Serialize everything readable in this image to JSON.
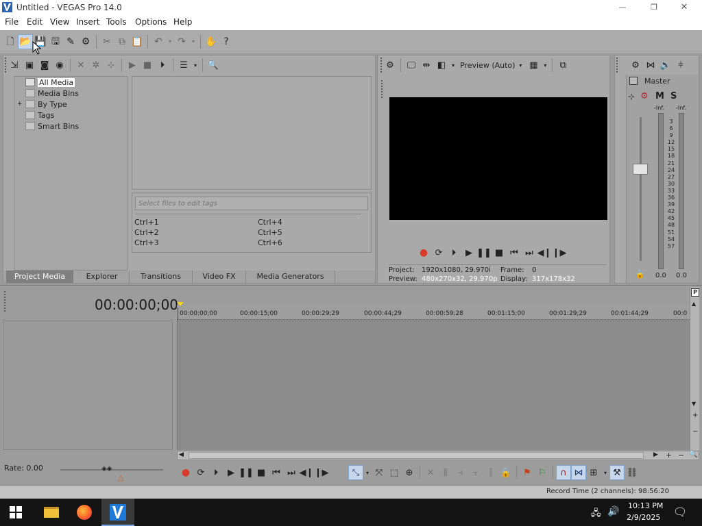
{
  "window": {
    "title": "Untitled - VEGAS Pro 14.0",
    "minimize": "—",
    "maximize": "❐",
    "close": "✕"
  },
  "menu": [
    "File",
    "Edit",
    "View",
    "Insert",
    "Tools",
    "Options",
    "Help"
  ],
  "project_media": {
    "tree": [
      {
        "label": "All Media",
        "expand": ""
      },
      {
        "label": "Media Bins",
        "expand": ""
      },
      {
        "label": "By Type",
        "expand": "+"
      },
      {
        "label": "Tags",
        "expand": ""
      },
      {
        "label": "Smart Bins",
        "expand": ""
      }
    ],
    "tags_placeholder": "Select files to edit tags",
    "shortcuts": [
      "Ctrl+1",
      "Ctrl+2",
      "Ctrl+3",
      "Ctrl+4",
      "Ctrl+5",
      "Ctrl+6"
    ]
  },
  "dock_tabs": [
    "Project Media",
    "Explorer",
    "Transitions",
    "Video FX",
    "Media Generators"
  ],
  "preview": {
    "mode": "Preview (Auto)",
    "project_label": "Project:",
    "project_value": "1920x1080, 29.970i",
    "preview_label": "Preview:",
    "preview_value": "480x270x32, 29.970p",
    "frame_label": "Frame:",
    "frame_value": "0",
    "display_label": "Display:",
    "display_value": "317x178x32"
  },
  "master": {
    "title": "Master",
    "m_label": "M",
    "s_label": "S",
    "inf_left": "-Inf.",
    "inf_right": "-Inf.",
    "scale": [
      "3",
      "6",
      "9",
      "12",
      "15",
      "18",
      "21",
      "24",
      "27",
      "30",
      "33",
      "36",
      "39",
      "42",
      "45",
      "48",
      "51",
      "54",
      "57"
    ],
    "value_left": "0.0",
    "value_right": "0.0"
  },
  "timeline": {
    "timecode": "00:00:00;00",
    "ruler": [
      "00:00:00;00",
      "00:00:15;00",
      "00:00:29;29",
      "00:00:44;29",
      "00:00:59;28",
      "00:01:15;00",
      "00:01:29;29",
      "00:01:44;29",
      "00:0"
    ],
    "rate": "Rate: 0.00",
    "record_time": "Record Time (2 channels): 98:56:20"
  },
  "taskbar": {
    "time": "10:13 PM",
    "date": "2/9/2025"
  },
  "colors": {
    "accent_blue": "#3a6fb0",
    "record_red": "#d63a2a",
    "panel_bg": "#a9a9a9",
    "timeline_bg": "#8c8c8c"
  }
}
